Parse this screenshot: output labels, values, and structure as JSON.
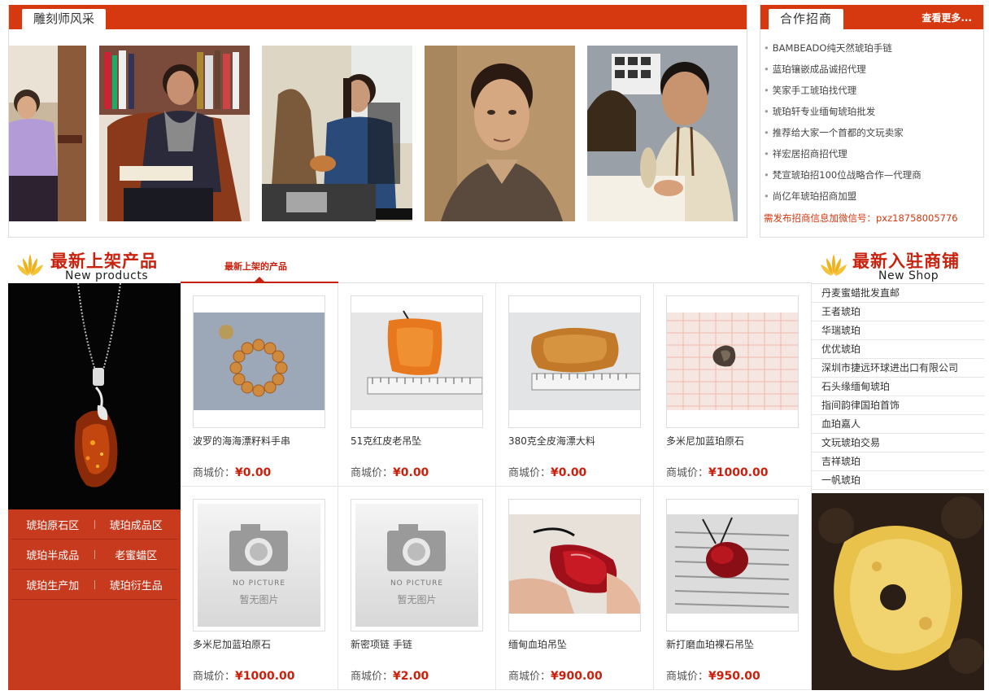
{
  "carvers": {
    "title": "雕刻师风采",
    "photo_count": 5
  },
  "recruit": {
    "title": "合作招商",
    "more": "查看更多...",
    "items": [
      "BAMBEADO纯天然琥珀手链",
      "蓝珀镶嵌成品诚招代理",
      "笑家手工琥珀找代理",
      "琥珀轩专业缅甸琥珀批发",
      "推荐给大家一个首都的文玩卖家",
      "祥宏居招商招代理",
      "梵宣琥珀招100位战略合作—代理商",
      "尚亿年琥珀招商加盟"
    ],
    "wechat_note": "需发布招商信息加微信号：pxz18758005776"
  },
  "new_products": {
    "title_cn": "最新上架产品",
    "title_en": "New products",
    "tab_label": "最新上架的产品"
  },
  "categories": [
    [
      "琥珀原石区",
      "琥珀成品区"
    ],
    [
      "琥珀半成品",
      "老蜜蜡区"
    ],
    [
      "琥珀生产加",
      "琥珀衍生品"
    ]
  ],
  "products": [
    {
      "name": "波罗的海海漂籽料手串",
      "price_label": "商城价：",
      "price": "¥0.00",
      "image": "bracelet"
    },
    {
      "name": "51克红皮老吊坠",
      "price_label": "商城价：",
      "price": "¥0.00",
      "image": "pendant-ruler"
    },
    {
      "name": "380克全皮海漂大料",
      "price_label": "商城价：",
      "price": "¥0.00",
      "image": "raw-ruler"
    },
    {
      "name": "多米尼加蓝珀原石",
      "price_label": "商城价：",
      "price": "¥1000.00",
      "image": "small-stone"
    },
    {
      "name": "多米尼加蓝珀原石",
      "price_label": "商城价：",
      "price": "¥1000.00",
      "image": "no-picture"
    },
    {
      "name": "新密项链 手链",
      "price_label": "商城价：",
      "price": "¥2.00",
      "image": "no-picture"
    },
    {
      "name": "缅甸血珀吊坠",
      "price_label": "商城价：",
      "price": "¥900.00",
      "image": "red-pendant"
    },
    {
      "name": "新打磨血珀裸石吊坠",
      "price_label": "商城价：",
      "price": "¥950.00",
      "image": "red-pendant-paper"
    }
  ],
  "placeholder": {
    "en": "NO PICTURE",
    "cn": "暂无图片"
  },
  "new_shops": {
    "title_cn": "最新入驻商铺",
    "title_en": "New Shop",
    "items": [
      "丹麦蜜蜡批发直邮",
      "王者琥珀",
      "华瑞琥珀",
      "优优琥珀",
      "深圳市捷远环球进出口有限公司",
      "石头缘缅甸琥珀",
      "指间韵律国珀首饰",
      "血珀嘉人",
      "文玩琥珀交易",
      "吉祥琥珀",
      "一帆琥珀"
    ]
  },
  "colors": {
    "brand_red": "#d6380f",
    "price_red": "#c9210d",
    "category_bg": "#c83a1e"
  }
}
